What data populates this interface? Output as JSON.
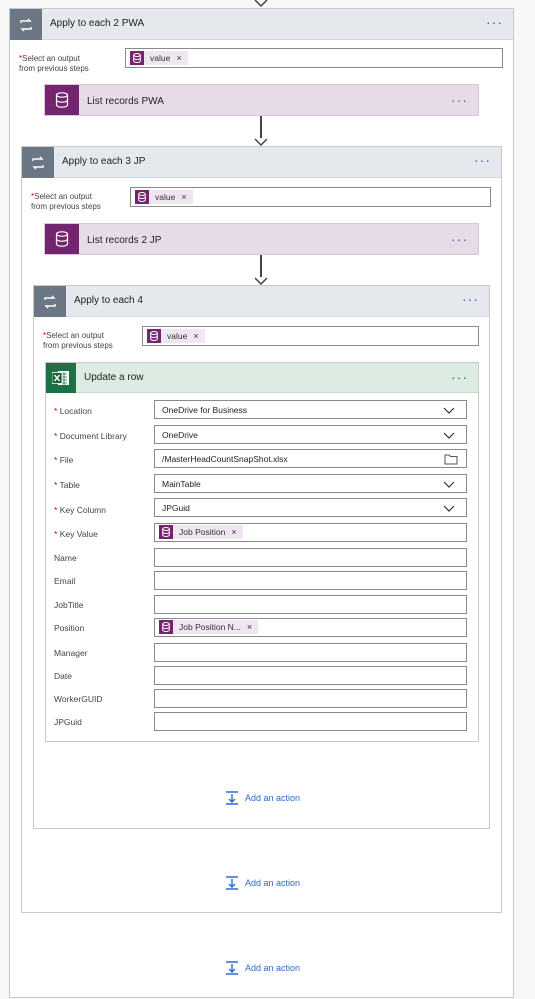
{
  "loops": {
    "pwa": {
      "title": "Apply to each 2 PWA",
      "token": "value"
    },
    "jp": {
      "title": "Apply to each 3 JP",
      "token": "value"
    },
    "four": {
      "title": "Apply to each 4",
      "token": "value"
    }
  },
  "select_output": {
    "line1": "Select an output",
    "line2": "from previous steps"
  },
  "actions": {
    "list_pwa": "List records PWA",
    "list_jp": "List records 2 JP"
  },
  "update_row": {
    "title": "Update a row",
    "fields": {
      "location": {
        "label": "Location",
        "value": "OneDrive for Business"
      },
      "doclib": {
        "label": "Document Library",
        "value": "OneDrive"
      },
      "file": {
        "label": "File",
        "value": "/MasterHeadCountSnapShot.xlsx"
      },
      "table": {
        "label": "Table",
        "value": "MainTable"
      },
      "keycol": {
        "label": "Key Column",
        "value": "JPGuid"
      },
      "keyval": {
        "label": "Key Value",
        "token": "Job Position"
      },
      "name": {
        "label": "Name"
      },
      "email": {
        "label": "Email"
      },
      "jobtitle": {
        "label": "JobTitle"
      },
      "position": {
        "label": "Position",
        "token": "Job Position N..."
      },
      "manager": {
        "label": "Manager"
      },
      "date": {
        "label": "Date"
      },
      "workerguid": {
        "label": "WorkerGUID"
      },
      "jpguid": {
        "label": "JPGuid"
      }
    }
  },
  "add_action": "Add an action",
  "more_menu": "···",
  "colors": {
    "loop_icon": "#6b7785",
    "dataverse": "#74256f",
    "excel": "#1f7145",
    "link": "#2b6bd3",
    "required": "#cc0000"
  },
  "icons": [
    "loop-icon",
    "database-icon",
    "excel-icon",
    "chevron-down-icon",
    "folder-icon",
    "add-action-icon",
    "close-icon"
  ]
}
